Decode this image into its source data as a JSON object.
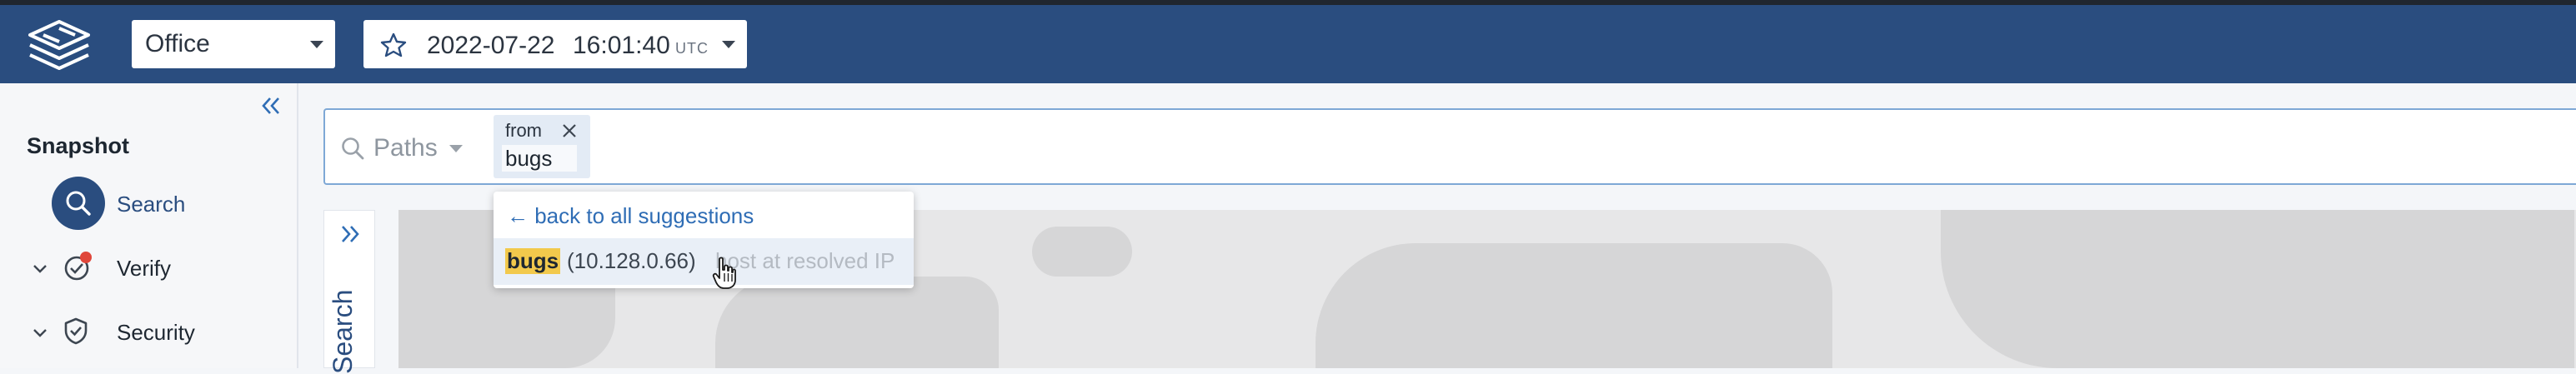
{
  "header": {
    "network_select": {
      "value": "Office"
    },
    "snapshot_select": {
      "date": "2022-07-22",
      "time": "16:01:40",
      "tz": "UTC"
    }
  },
  "sidebar": {
    "title": "Snapshot",
    "items": [
      {
        "label": "Search",
        "icon": "search-icon",
        "active": true
      },
      {
        "label": "Verify",
        "icon": "verify-icon",
        "badge": "red-dot"
      },
      {
        "label": "Security",
        "icon": "shield-icon"
      }
    ]
  },
  "searchbar": {
    "mode": "Paths",
    "chip": {
      "key": "from",
      "value": "bugs"
    }
  },
  "side_tab": {
    "label": "Search"
  },
  "suggestions": {
    "back_label": "← back to all suggestions",
    "items": [
      {
        "name": "bugs",
        "ip": "(10.128.0.66)",
        "description": "host at resolved IP"
      }
    ]
  },
  "colors": {
    "header_bg": "#2a4d7f",
    "accent": "#2f6db5",
    "highlight": "#f2c94c",
    "badge": "#e0463a"
  }
}
